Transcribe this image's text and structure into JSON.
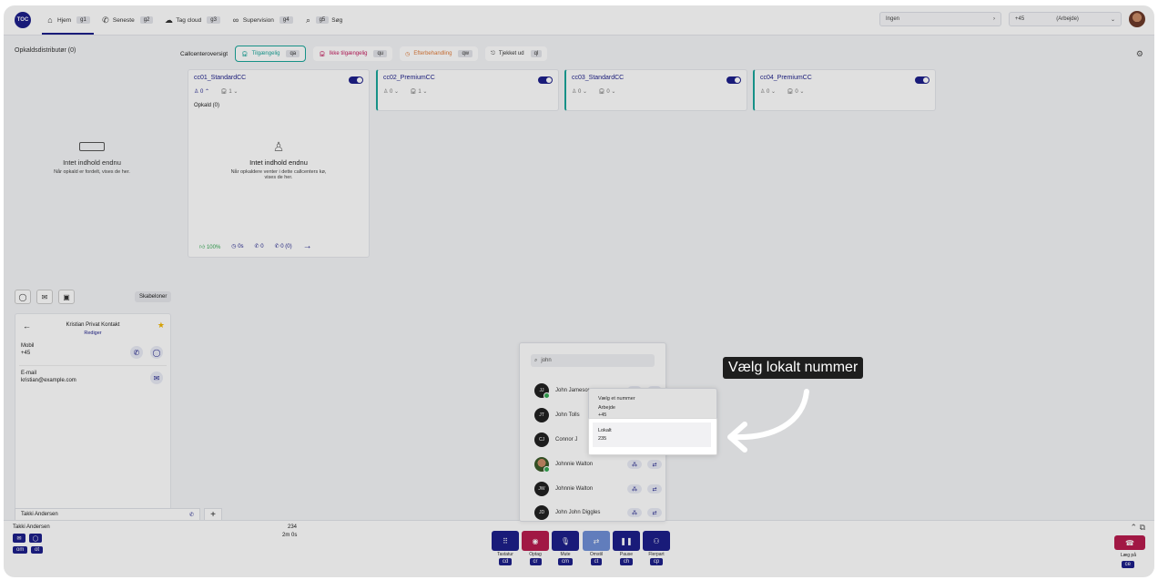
{
  "app": {
    "logo_text": "TOC"
  },
  "nav": [
    {
      "label": "Hjem",
      "key": "g1",
      "icon": "home-icon"
    },
    {
      "label": "Seneste",
      "key": "g2",
      "icon": "phone-icon"
    },
    {
      "label": "Tag cloud",
      "key": "g3",
      "icon": "cloud-icon"
    },
    {
      "label": "Supervision",
      "key": "g4",
      "icon": "glasses-icon"
    },
    {
      "label": "Søg",
      "key": "g5",
      "icon": "search-icon"
    }
  ],
  "topright": {
    "queue_select": "Ingen",
    "phone_prefix": "+45",
    "phone_label": "(Arbejde)"
  },
  "left": {
    "title": "Opkaldsdistributør (0)",
    "empty_title": "Intet indhold endnu",
    "empty_desc": "Når opkald er fordelt, vises de her."
  },
  "status": {
    "label": "Callcenteroversigt",
    "items": [
      {
        "label": "Tilgængelig",
        "key": "qa",
        "color": "#1aa59a"
      },
      {
        "label": "Ikke tilgængelig",
        "key": "qu",
        "color": "#c2185b"
      },
      {
        "label": "Efterbehandling",
        "key": "qw",
        "color": "#e07b39"
      },
      {
        "label": "Tjekket ud",
        "key": "ql",
        "color": "#333333"
      }
    ]
  },
  "cards": [
    {
      "name": "cc01_StandardCC",
      "agents": "0",
      "queue": "1",
      "calls_label": "Opkald (0)",
      "empty_title": "Intet indhold endnu",
      "empty_desc": "Når opkaldere venter i dette callcenters kø, vises de her.",
      "stat_percent": "100%",
      "stat_time": "0s",
      "stat_calls": "0",
      "stat_missed": "0 (0)"
    },
    {
      "name": "cc02_PremiumCC",
      "agents": "0",
      "queue": "1"
    },
    {
      "name": "cc03_StandardCC",
      "agents": "0",
      "queue": "0"
    },
    {
      "name": "cc04_PremiumCC",
      "agents": "0",
      "queue": "0"
    }
  ],
  "contact_tabs": {
    "templates_label": "Skabeloner"
  },
  "contact": {
    "name": "Kristian Privat Kontakt",
    "edit": "Rediger",
    "mobile_label": "Mobil",
    "mobile_value": "+45",
    "email_label": "E-mail",
    "email_value": "kristian@example.com"
  },
  "bottom_tab": {
    "name": "Takki Andersen"
  },
  "footer": {
    "name": "Takki Andersen",
    "keys_row1": [
      "",
      ""
    ],
    "keys_row2": [
      "om",
      "ot"
    ],
    "ext": "234",
    "timer": "2m 0s",
    "hangup_label": "Læg på",
    "hangup_key": "ce"
  },
  "controls": [
    {
      "label": "Tastatur",
      "key": "cd",
      "icon": "dialpad-icon",
      "variant": ""
    },
    {
      "label": "Optag",
      "key": "cr",
      "icon": "record-icon",
      "variant": "red"
    },
    {
      "label": "Mute",
      "key": "cm",
      "icon": "mic-icon",
      "variant": ""
    },
    {
      "label": "Omstil",
      "key": "ct",
      "icon": "transfer-icon",
      "variant": "light"
    },
    {
      "label": "Pause",
      "key": "ch",
      "icon": "pause-icon",
      "variant": ""
    },
    {
      "label": "Flerpart",
      "key": "cp",
      "icon": "conference-icon",
      "variant": ""
    }
  ],
  "dialer": {
    "search_value": "john",
    "contacts": [
      {
        "initials": "JJ",
        "name": "John Jameson"
      },
      {
        "initials": "JT",
        "name": "John Tolls"
      },
      {
        "initials": "CJ",
        "name": "Connor J"
      },
      {
        "initials": "",
        "name": "Johnnie Walton"
      },
      {
        "initials": "JW",
        "name": "Johnnie Walton"
      },
      {
        "initials": "JD",
        "name": "John John Diggles"
      }
    ]
  },
  "number_popup": {
    "title": "Vælg et nummer",
    "work_label": "Arbejde",
    "work_value": "+45",
    "local_label": "Lokalt",
    "local_value": "235"
  },
  "tooltip": "Vælg lokalt nummer"
}
